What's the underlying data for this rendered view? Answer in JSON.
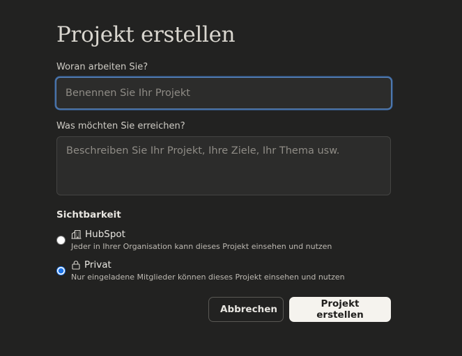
{
  "dialog": {
    "title": "Projekt erstellen",
    "name_label": "Woran arbeiten Sie?",
    "name_placeholder": "Benennen Sie Ihr Projekt",
    "name_value": "",
    "description_label": "Was möchten Sie erreichen?",
    "description_placeholder": "Beschreiben Sie Ihr Projekt, Ihre Ziele, Ihr Thema usw.",
    "description_value": "",
    "visibility": {
      "heading": "Sichtbarkeit",
      "options": [
        {
          "title": "HubSpot",
          "description": "Jeder in Ihrer Organisation kann dieses Projekt einsehen und nutzen",
          "icon": "building-icon",
          "selected": false
        },
        {
          "title": "Privat",
          "description": "Nur eingeladene Mitglieder können dieses Projekt einsehen und nutzen",
          "icon": "lock-icon",
          "selected": true
        }
      ]
    },
    "buttons": {
      "cancel": "Abbrechen",
      "create": "Projekt erstellen"
    }
  },
  "colors": {
    "background": "#222221",
    "focus_ring": "#3d6aa5",
    "primary_button_bg": "#f5f3ee",
    "radio_accent": "#1a73e8"
  }
}
